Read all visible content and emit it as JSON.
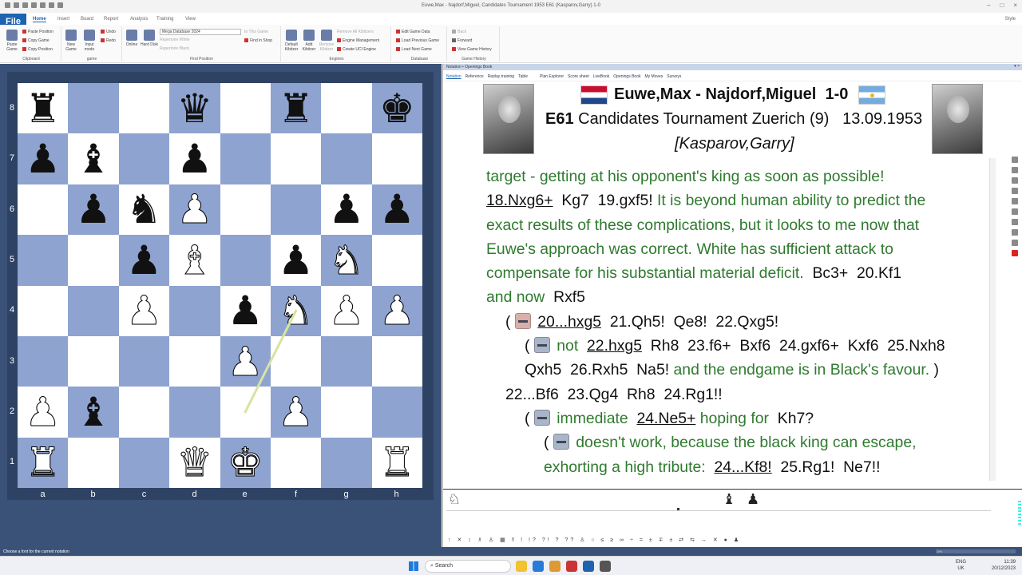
{
  "window": {
    "title": "Euwe,Max - Najdorf,Miguel, Candidates Tournament 1953  E61  (Kasparov,Garry)  1-0"
  },
  "menu": {
    "file": "File",
    "tabs": [
      "Home",
      "Insert",
      "Board",
      "Report",
      "Analysis",
      "Training",
      "View"
    ],
    "style": "Style"
  },
  "ribbon": {
    "clipboard": {
      "label": "Clipboard",
      "paste_game": "Paste Game",
      "paste_position": "Paste Position",
      "copy_game": "Copy Game",
      "copy_position": "Copy Position"
    },
    "game": {
      "label": "game",
      "new_game": "New Game",
      "input_mode": "Input mode",
      "undo": "Undo",
      "redo": "Redo"
    },
    "find_position": {
      "label": "Find Position",
      "online": "Online",
      "hard_disk": "Hard Disk",
      "database": "Mega Database 2024",
      "repertoire_white": "Repertoire White",
      "repertoire_black": "Repertoire Black",
      "to_this_game": "to This Game",
      "find_in_shop": "Find in Shop"
    },
    "engines": {
      "label": "Engines",
      "default_kibitzer": "Default Kibitzer",
      "add_kibitzer": "Add Kibitzer",
      "remove_kibitzer": "Remove Kibitzer",
      "remove_all": "Remove All Kibitzers",
      "engine_management": "Engine Management",
      "create_uci": "Create UCI Engine"
    },
    "database": {
      "label": "Database",
      "edit_game_data": "Edit Game Data",
      "load_previous": "Load Previous Game",
      "load_next": "Load Next Game"
    },
    "game_history": {
      "label": "Game History",
      "back": "Back",
      "forward": "Forward",
      "view_history": "View Game History"
    }
  },
  "board": {
    "ranks": [
      "8",
      "7",
      "6",
      "5",
      "4",
      "3",
      "2",
      "1"
    ],
    "files": [
      "a",
      "b",
      "c",
      "d",
      "e",
      "f",
      "g",
      "h"
    ],
    "rows": [
      [
        "bR",
        "",
        "",
        "bQ",
        "",
        "bR",
        "",
        "bK"
      ],
      [
        "bP",
        "bB",
        "",
        "bP",
        "",
        "",
        "",
        ""
      ],
      [
        "",
        "bP",
        "bN",
        "wP",
        "",
        "",
        "bP",
        "bP"
      ],
      [
        "",
        "",
        "bP",
        "wB",
        "",
        "bP",
        "wN",
        ""
      ],
      [
        "",
        "",
        "wP",
        "",
        "bP",
        "wN",
        "wP",
        "wP"
      ],
      [
        "",
        "",
        "",
        "",
        "wP",
        "",
        "",
        ""
      ],
      [
        "wP",
        "bB",
        "",
        "",
        "",
        "wP",
        "",
        ""
      ],
      [
        "wR",
        "",
        "",
        "wQ",
        "wK",
        "",
        "",
        "wR"
      ]
    ],
    "arrow": {
      "from": "e2",
      "to": "f4",
      "color": "#d8e3a0"
    }
  },
  "notation": {
    "tabs": "Notation • Openings Book",
    "subtabs": [
      "Notation",
      "Reference",
      "Replay training",
      "Table",
      "Plan Explorer",
      "Score sheet",
      "LiveBook",
      "Openings Book",
      "My Moves",
      "Surveys"
    ],
    "header": {
      "players": "Euwe,Max - Najdorf,Miguel",
      "result": "1-0",
      "eco": "E61",
      "event": "Candidates Tournament Zuerich (9)",
      "date": "13.09.1953",
      "annotator": "[Kasparov,Garry]"
    },
    "body": {
      "l1": "target - getting at his opponent's king as soon as possible!",
      "l2_m1": "18.Nxg6+",
      "l2_m2": "Kg7",
      "l2_m3": "19.gxf5!",
      "l2_t": "It is beyond human ability to predict the",
      "l3": "exact results of these complications, but it looks to me now that",
      "l4": "Euwe's approach was correct. White has sufficient attack to",
      "l5_t": "compensate for his substantial material deficit.",
      "l5_m1": "Bc3+",
      "l5_m2": "20.Kf1",
      "l6_t": "and now",
      "l6_m": "Rxf5",
      "l7_open": "(",
      "l7_m1": "20...hxg5",
      "l7_m2": "21.Qh5!",
      "l7_m3": "Qe8!",
      "l7_m4": "22.Qxg5!",
      "l8_open": "(",
      "l8_t": "not",
      "l8_m1": "22.hxg5",
      "l8_m2": "Rh8",
      "l8_m3": "23.f6+",
      "l8_m4": "Bxf6",
      "l8_m5": "24.gxf6+",
      "l8_m6": "Kxf6",
      "l8_m7": "25.Nxh8",
      "l9_m1": "Qxh5",
      "l9_m2": "26.Rxh5",
      "l9_m3": "Na5!",
      "l9_t": "and the endgame is in Black's favour.",
      "l9_close": ")",
      "l10_m1": "22...Bf6",
      "l10_m2": "23.Qg4",
      "l10_m3": "Rh8",
      "l10_m4": "24.Rg1!!",
      "l11_open": "(",
      "l11_t1": "immediate",
      "l11_m1": "24.Ne5+",
      "l11_t2": "hoping for",
      "l11_m2": "Kh7?",
      "l12_open": "(",
      "l12_t": "doesn't work, because the black king can escape,",
      "l13_t": "exhorting a high tribute:",
      "l13_m1": "24...Kf8!",
      "l13_m2": "25.Rg1!",
      "l13_m3": "Ne7!!"
    }
  },
  "statusbar": {
    "text": "Choose a font for the current notation",
    "progress": "0%"
  },
  "taskbar": {
    "search": "Search",
    "lang1": "ENG",
    "lang2": "UK",
    "time": "11:39",
    "date": "20/12/2023"
  }
}
